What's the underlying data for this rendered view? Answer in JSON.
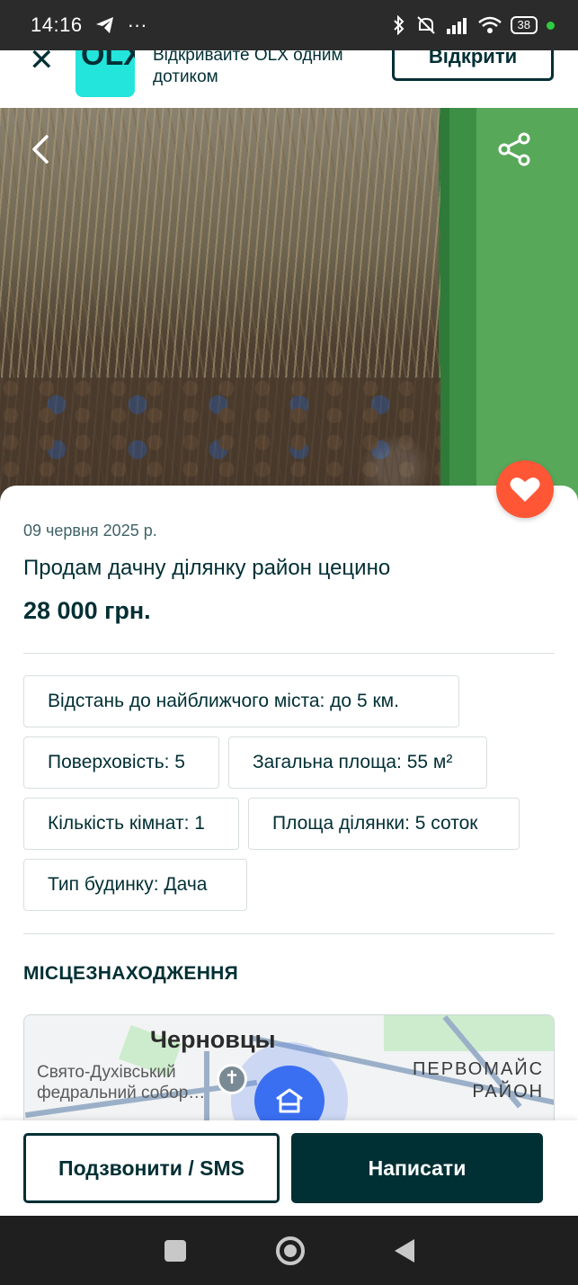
{
  "status_bar": {
    "time": "14:16",
    "telegram_icon": "telegram-icon",
    "more": "···",
    "battery": "38"
  },
  "banner": {
    "logo_text": "OLX",
    "text": "Відкривайте OLX одним дотиком",
    "open_label": "Відкрити"
  },
  "listing": {
    "date": "09 червня 2025 р.",
    "title": "Продам дачну ділянку район цецино",
    "price": "28 000 грн.",
    "params": [
      "Відстань до найближчого міста: до 5 км.",
      "Поверховість: 5",
      "Загальна площа: 55 м²",
      "Кількість кімнат: 1",
      "Площа ділянки: 5 соток",
      "Тип будинку: Дача"
    ]
  },
  "location": {
    "section_title": "МІСЦЕЗНАХОДЖЕННЯ",
    "map_city": "Черновцы",
    "map_poi_line1": "Свято-Духівський",
    "map_poi_line2": "федральний собор…",
    "map_district_line1": "ПЕРВОМАЙС",
    "map_district_line2": "РАЙОН"
  },
  "actions": {
    "call_label": "Подзвонити / SMS",
    "write_label": "Написати"
  },
  "colors": {
    "brand_dark": "#002f34",
    "favorite": "#ff5636",
    "map_pin": "#3a6ff2",
    "olx_teal": "#23e5db"
  }
}
